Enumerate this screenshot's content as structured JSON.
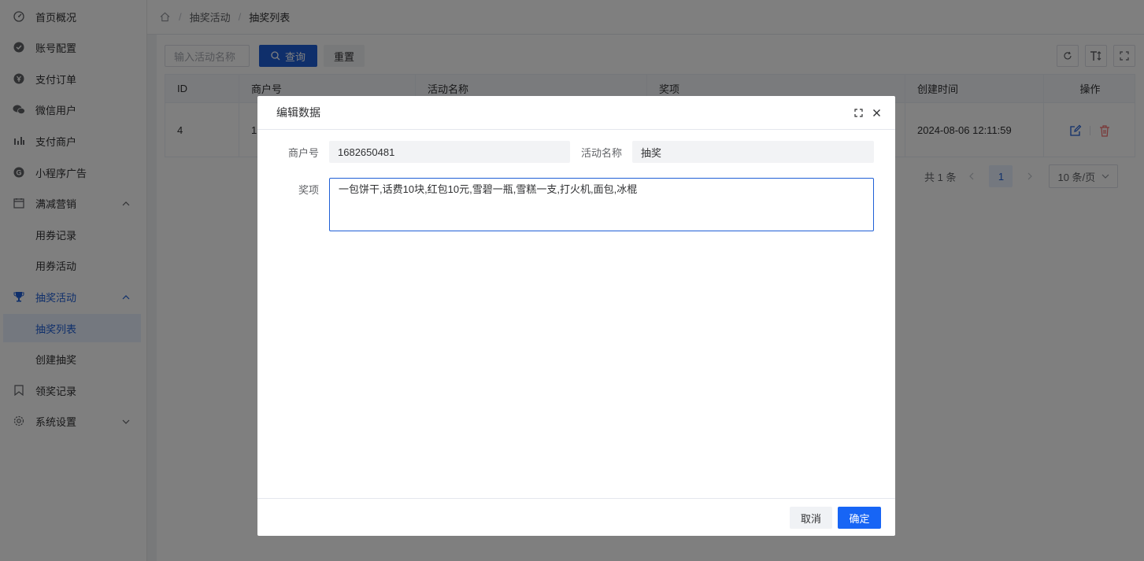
{
  "sidebar": {
    "items": [
      {
        "label": "首页概况",
        "icon": "dashboard-icon"
      },
      {
        "label": "账号配置",
        "icon": "account-icon"
      },
      {
        "label": "支付订单",
        "icon": "yen-icon"
      },
      {
        "label": "微信用户",
        "icon": "wechat-icon"
      },
      {
        "label": "支付商户",
        "icon": "bar-chart-icon"
      },
      {
        "label": "小程序广告",
        "icon": "g-icon"
      },
      {
        "label": "满减营销",
        "icon": "calendar-icon",
        "expanded": true
      },
      {
        "label": "用券记录"
      },
      {
        "label": "用券活动"
      },
      {
        "label": "抽奖活动",
        "icon": "trophy-icon",
        "expanded": true
      },
      {
        "label": "抽奖列表",
        "active": true
      },
      {
        "label": "创建抽奖"
      },
      {
        "label": "领奖记录",
        "icon": "bookmark-icon"
      },
      {
        "label": "系统设置",
        "icon": "gear-icon",
        "expanded": false
      }
    ]
  },
  "breadcrumb": {
    "home_icon": "home-icon",
    "items": [
      "抽奖活动",
      "抽奖列表"
    ]
  },
  "toolbar": {
    "search_placeholder": "输入活动名称",
    "search_label": "查询",
    "reset_label": "重置",
    "tool_icons": [
      "refresh-icon",
      "font-size-icon",
      "fullscreen-icon"
    ]
  },
  "table": {
    "columns": [
      "ID",
      "商户号",
      "活动名称",
      "奖项",
      "创建时间",
      "操作"
    ],
    "rows": [
      {
        "id": "4",
        "merchant_partial": "1",
        "created": "2024-08-06 12:11:59"
      }
    ]
  },
  "pagination": {
    "total": "共 1 条",
    "page": "1",
    "page_size": "10 条/页"
  },
  "dialog": {
    "title": "编辑数据",
    "merchant_label": "商户号",
    "merchant_value": "1682650481",
    "activity_label": "活动名称",
    "activity_value": "抽奖",
    "prize_label": "奖项",
    "prize_value": "一包饼干,话费10块,红包10元,雪碧一瓶,雪糕一支,打火机,面包,冰棍",
    "cancel_label": "取消",
    "confirm_label": "确定"
  },
  "colors": {
    "primary": "#1f5fd6",
    "danger": "#f56c6c"
  }
}
